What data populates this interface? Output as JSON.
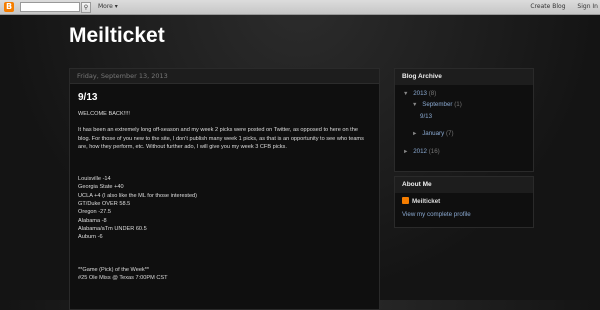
{
  "navbar": {
    "logo": "B",
    "search_button": "",
    "more": "More ▾",
    "create_blog": "Create Blog",
    "sign_in": "Sign In"
  },
  "blog": {
    "title": "Meilticket"
  },
  "post": {
    "date": "Friday, September 13, 2013",
    "title": "9/13",
    "intro": "WELCOME BACK!!!!",
    "paragraph": "It has been an extremely long off-season and my week 2 picks were posted on Twitter, as opposed to here on the blog. For those of you new to the site, I don't publish many week 1 picks, as that is an opportunity to see who teams are, how they perform, etc. Without further ado, I will give you my week 3 CFB picks.",
    "picks": [
      "Louisville -14",
      "Georgia State +40",
      "UCLA +4 (I also like the ML for those interested)",
      "GT/Duke OVER 58.5",
      "Oregon -27.5",
      "Alabama -8",
      "Alabama/aTm UNDER 60.5",
      "Auburn -6"
    ],
    "goty_heading": "**Game (Pick) of the Week**",
    "goty_line": "#25 Ole Miss @ Texas 7:00PM CST"
  },
  "archive": {
    "header": "Blog Archive",
    "year1": "2013",
    "year1_count": "(8)",
    "month1": "September",
    "month1_count": "(1)",
    "post1": "9/13",
    "month2": "January",
    "month2_count": "(7)",
    "year2": "2012",
    "year2_count": "(16)"
  },
  "about": {
    "header": "About Me",
    "name": "Meilticket",
    "profile_link": "View my complete profile"
  },
  "colors": {
    "accent": "#f57d00",
    "link": "#8aa9d1",
    "background": "#1b1b1b"
  }
}
